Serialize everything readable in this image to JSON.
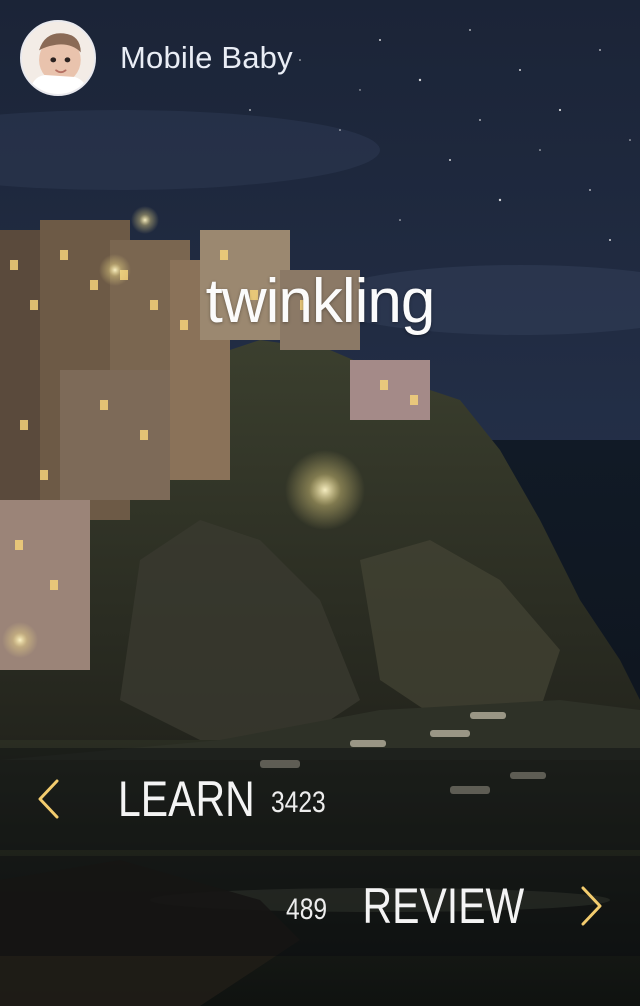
{
  "profile": {
    "name": "Mobile Baby",
    "avatar_icon": "baby-avatar"
  },
  "card": {
    "word": "twinkling",
    "background": "night-coastal-village-photo"
  },
  "learn": {
    "label": "LEARN",
    "count": "3423",
    "icon": "chevron-left-icon"
  },
  "review": {
    "label": "REVIEW",
    "count": "489",
    "icon": "chevron-right-icon"
  },
  "colors": {
    "accent": "#f3cc6e",
    "bar_bg": "rgba(8,10,16,0.40)",
    "text": "#f4f4f4"
  }
}
